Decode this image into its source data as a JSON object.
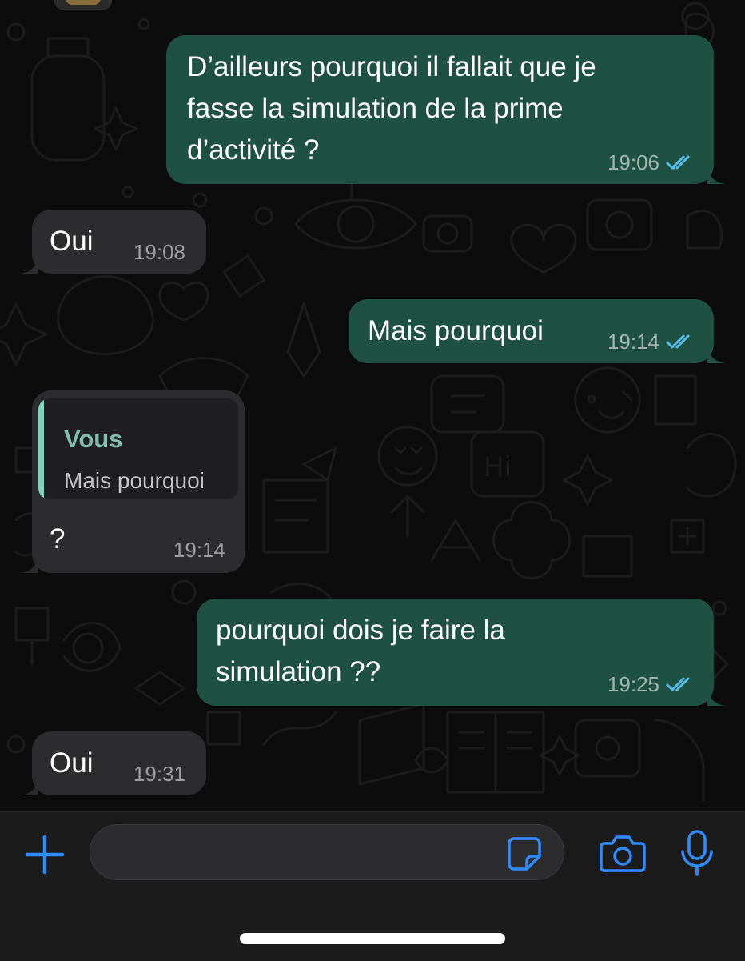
{
  "messages": [
    {
      "direction": "outgoing",
      "text": "D’ailleurs pourquoi il fallait que je\nfasse la simulation de la prime\nd’activité ?",
      "time": "19:06",
      "status": "read"
    },
    {
      "direction": "incoming",
      "text": "Oui",
      "time": "19:08"
    },
    {
      "direction": "outgoing",
      "text": "Mais pourquoi",
      "time": "19:14",
      "status": "read"
    },
    {
      "direction": "incoming",
      "quote": {
        "author": "Vous",
        "text": "Mais pourquoi"
      },
      "text": "?",
      "time": "19:14"
    },
    {
      "direction": "outgoing",
      "text": "pourquoi dois je faire la\nsimulation ??",
      "time": "19:25",
      "status": "read"
    },
    {
      "direction": "incoming",
      "text": "Oui",
      "time": "19:31"
    }
  ],
  "input_bar": {
    "placeholder": "",
    "icons": [
      "plus-icon",
      "sticker-icon",
      "camera-icon",
      "microphone-icon"
    ]
  },
  "colors": {
    "outgoing_bubble": "#1f5143",
    "incoming_bubble": "#2c2c2e",
    "accent": "#2f8cff",
    "read_ticks": "#53bdeb",
    "quote_accent": "#7fd3bf"
  }
}
